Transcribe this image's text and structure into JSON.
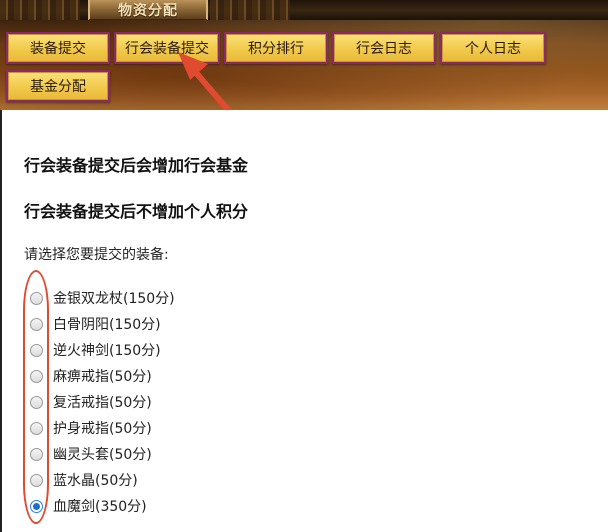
{
  "header": {
    "title": "物资分配"
  },
  "tabs": [
    {
      "label": "装备提交"
    },
    {
      "label": "行会装备提交"
    },
    {
      "label": "积分排行"
    },
    {
      "label": "行会日志"
    },
    {
      "label": "个人日志"
    },
    {
      "label": "基金分配"
    }
  ],
  "info": {
    "line1": "行会装备提交后会增加行会基金",
    "line2": "行会装备提交后不增加个人积分"
  },
  "form": {
    "prompt": "请选择您要提交的装备:",
    "options": [
      {
        "label": "金银双龙杖(150分)",
        "checked": false
      },
      {
        "label": "白骨阴阳(150分)",
        "checked": false
      },
      {
        "label": "逆火神剑(150分)",
        "checked": false
      },
      {
        "label": "麻痹戒指(50分)",
        "checked": false
      },
      {
        "label": "复活戒指(50分)",
        "checked": false
      },
      {
        "label": "护身戒指(50分)",
        "checked": false
      },
      {
        "label": "幽灵头套(50分)",
        "checked": false
      },
      {
        "label": "蓝水晶(50分)",
        "checked": false
      },
      {
        "label": "血魔剑(350分)",
        "checked": true
      }
    ]
  },
  "annotation_color": "#e04a30",
  "accent": {
    "tab_bg": "#f2c94a",
    "tab_border": "#8a2a6a"
  }
}
